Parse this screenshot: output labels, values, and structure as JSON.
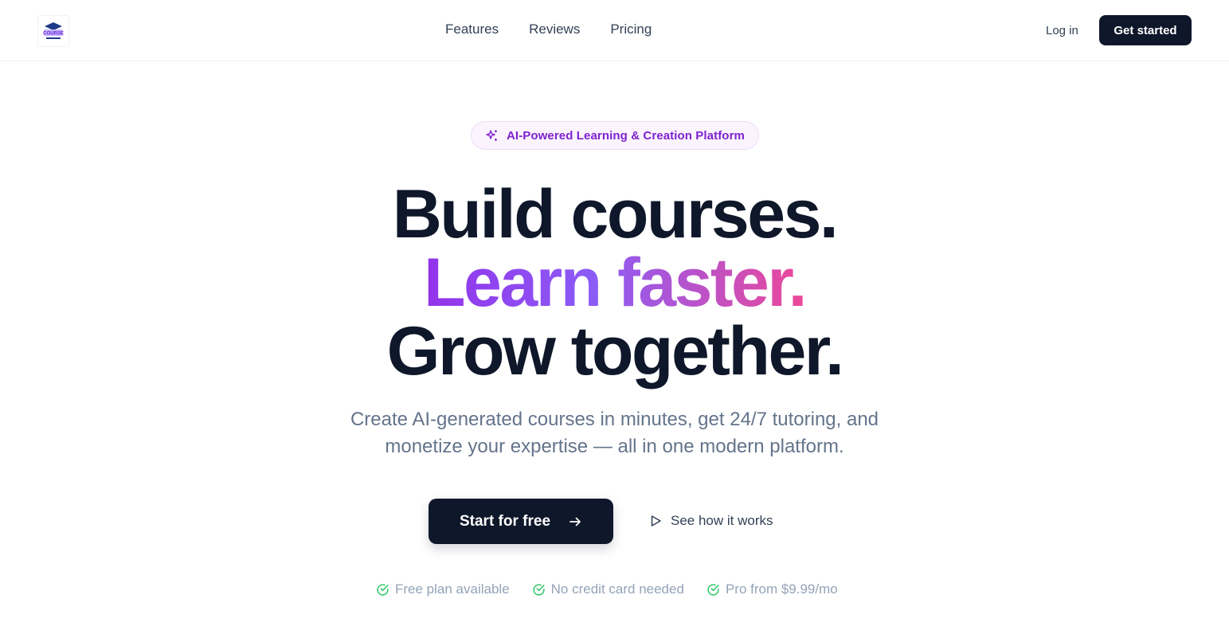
{
  "header": {
    "logo_icon": "course-logo-icon",
    "logo_text": "COURSE",
    "nav": [
      {
        "label": "Features"
      },
      {
        "label": "Reviews"
      },
      {
        "label": "Pricing"
      }
    ],
    "login_label": "Log in",
    "get_started_label": "Get started"
  },
  "hero": {
    "badge": {
      "icon": "sparkles-icon",
      "text": "AI-Powered Learning & Creation Platform"
    },
    "headline": {
      "line1": "Build courses.",
      "line2": "Learn faster.",
      "line3": "Grow together."
    },
    "subtitle": {
      "line1": "Create AI-generated courses in minutes, get 24/7 tutoring, and",
      "line2": "monetize your expertise — all in one modern platform."
    },
    "cta_primary": {
      "label": "Start for free",
      "icon": "arrow-right-icon"
    },
    "cta_secondary": {
      "label": "See how it works",
      "icon": "play-icon"
    },
    "perks": [
      {
        "icon": "check-circle-icon",
        "label": "Free plan available"
      },
      {
        "icon": "check-circle-icon",
        "label": "No credit card needed"
      },
      {
        "icon": "check-circle-icon",
        "label": "Pro from $9.99/mo"
      }
    ]
  },
  "colors": {
    "primary_dark": "#0f172a",
    "accent_purple": "#9333ea",
    "accent_pink": "#ec4899",
    "check_green": "#22c55e"
  }
}
